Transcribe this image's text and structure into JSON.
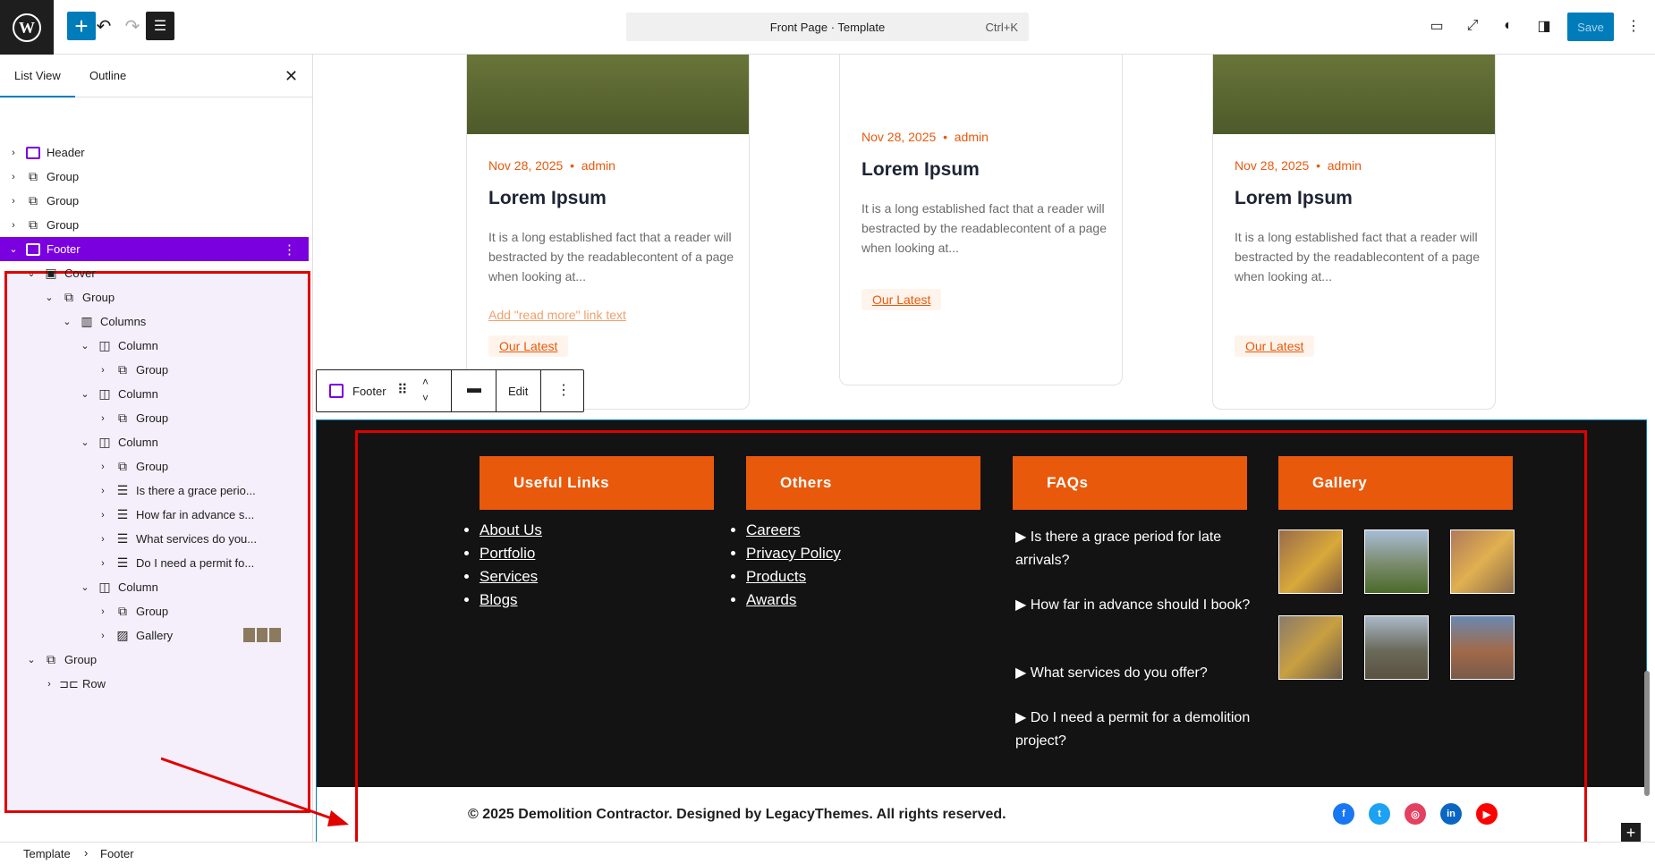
{
  "topbar": {
    "doc_title": "Front Page · Template",
    "shortcut": "Ctrl+K",
    "save_label": "Save"
  },
  "sidebar": {
    "tabs": [
      "List View",
      "Outline"
    ],
    "items": [
      {
        "label": "Header",
        "icon": "template-part-icon",
        "level": 0
      },
      {
        "label": "Group",
        "icon": "group-icon",
        "level": 0
      },
      {
        "label": "Group",
        "icon": "group-icon",
        "level": 0
      },
      {
        "label": "Group",
        "icon": "group-icon",
        "level": 0
      },
      {
        "label": "Footer",
        "icon": "template-part-icon",
        "level": 0
      },
      {
        "label": "Cover",
        "icon": "cover-icon",
        "level": 1
      },
      {
        "label": "Group",
        "icon": "group-icon",
        "level": 2
      },
      {
        "label": "Columns",
        "icon": "columns-icon",
        "level": 3
      },
      {
        "label": "Column",
        "icon": "column-icon",
        "level": 4
      },
      {
        "label": "Group",
        "icon": "group-icon",
        "level": 5
      },
      {
        "label": "Column",
        "icon": "column-icon",
        "level": 4
      },
      {
        "label": "Group",
        "icon": "group-icon",
        "level": 5
      },
      {
        "label": "Column",
        "icon": "column-icon",
        "level": 4
      },
      {
        "label": "Group",
        "icon": "group-icon",
        "level": 5
      },
      {
        "label": "Is there a grace perio...",
        "icon": "details-icon",
        "level": 5
      },
      {
        "label": "How far in advance s...",
        "icon": "details-icon",
        "level": 5
      },
      {
        "label": "What services do you...",
        "icon": "details-icon",
        "level": 5
      },
      {
        "label": "Do I need a permit fo...",
        "icon": "details-icon",
        "level": 5
      },
      {
        "label": "Column",
        "icon": "column-icon",
        "level": 4
      },
      {
        "label": "Group",
        "icon": "group-icon",
        "level": 5
      },
      {
        "label": "Gallery",
        "icon": "gallery-icon",
        "level": 5
      },
      {
        "label": "Group",
        "icon": "group-icon",
        "level": 1
      },
      {
        "label": "Row",
        "icon": "row-icon",
        "level": 2
      }
    ]
  },
  "cards": [
    {
      "date": "Nov 28, 2025",
      "author": "admin",
      "title": "Lorem Ipsum",
      "desc": "It is a long established fact that a reader will bestracted by the readablecontent of a page when looking at...",
      "readmore": "Add \"read more\" link text",
      "button": "Our Latest"
    },
    {
      "date": "Nov 28, 2025",
      "author": "admin",
      "title": "Lorem Ipsum",
      "desc": "It is a long established fact that a reader will bestracted by the readablecontent of a page when looking at...",
      "button": "Our Latest"
    },
    {
      "date": "Nov 28, 2025",
      "author": "admin",
      "title": "Lorem Ipsum",
      "desc": "It is a long established fact that a reader will bestracted by the readablecontent of a page when looking at...",
      "button": "Our Latest"
    }
  ],
  "block_toolbar": {
    "label": "Footer",
    "edit": "Edit"
  },
  "footer": {
    "headings": [
      "Useful Links",
      "Others",
      "FAQs",
      "Gallery"
    ],
    "useful_links": [
      "About Us",
      "Portfolio",
      "Services",
      "Blogs"
    ],
    "others": [
      "Careers",
      "Privacy Policy",
      "Products",
      "Awards"
    ],
    "faqs": [
      "Is there a grace period for late arrivals?",
      "How far in advance should I book?",
      "What services do you offer?",
      "Do I need a permit for a demolition project?"
    ],
    "copyright": "© 2025 Demolition Contractor. Designed by LegacyThemes. All rights reserved.",
    "social": [
      "facebook-icon",
      "twitter-icon",
      "instagram-icon",
      "linkedin-icon",
      "youtube-icon"
    ]
  },
  "breadcrumb": [
    "Template",
    "Footer"
  ],
  "colors": {
    "accent": "#e8590c",
    "wp_blue": "#007cba",
    "selection": "#7a00df",
    "highlight_red": "#e00000"
  }
}
